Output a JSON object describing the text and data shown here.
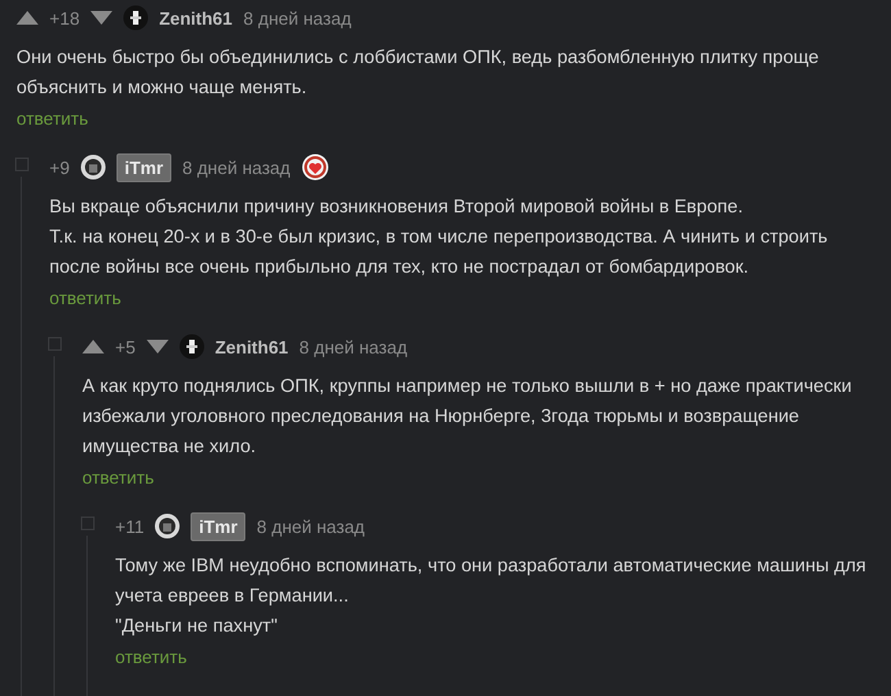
{
  "comments": [
    {
      "rating": "+18",
      "vote_arrows": true,
      "author": "Zenith61",
      "highlighted": false,
      "time": "8 дней назад",
      "award": false,
      "body": [
        "Они очень быстро бы объединились с лоббистами ОПК, ведь разбомбленную плитку проще",
        "объяснить и можно чаще менять."
      ],
      "reply": "ответить",
      "children": [
        {
          "rating": "+9",
          "vote_arrows": false,
          "author": "iTmr",
          "highlighted": true,
          "time": "8 дней назад",
          "award": true,
          "body": [
            "Вы вкраце объяснили причину возникновения Второй мировой войны в Европе.",
            "Т.к. на конец 20-х и в 30-е был кризис, в том числе перепроизводства. А чинить и строить",
            "после войны все очень прибыльно для тех, кто не пострадал от бомбардировок."
          ],
          "reply": "ответить",
          "children": [
            {
              "rating": "+5",
              "vote_arrows": true,
              "author": "Zenith61",
              "highlighted": false,
              "time": "8 дней назад",
              "award": false,
              "body": [
                "А как круто поднялись ОПК, круппы например не только вышли в + но даже практически",
                "избежали уголовного преследования на Нюрнберге, 3года тюрьмы и возвращение",
                "имущества не хило."
              ],
              "reply": "ответить",
              "children": [
                {
                  "rating": "+11",
                  "vote_arrows": false,
                  "author": "iTmr",
                  "highlighted": true,
                  "time": "8 дней назад",
                  "award": false,
                  "body": [
                    "Тому же IBM неудобно вспоминать, что они разработали автоматические машины для",
                    "учета евреев в Германии...",
                    "\"Деньги не пахнут\""
                  ],
                  "reply": "ответить"
                }
              ]
            }
          ]
        }
      ]
    }
  ]
}
